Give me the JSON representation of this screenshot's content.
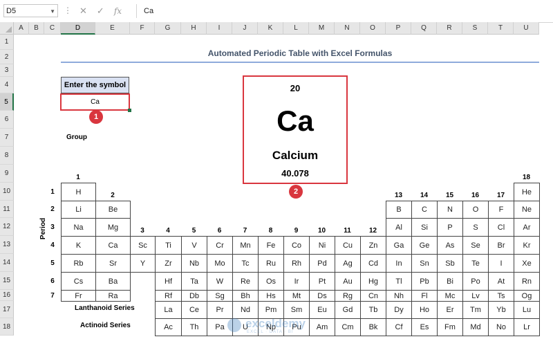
{
  "formula_bar": {
    "name_box": "D5",
    "fx_label": "fx",
    "cancel_icon": "close-icon",
    "enter_icon": "check-icon",
    "formula": "Ca"
  },
  "columns": [
    "A",
    "B",
    "C",
    "D",
    "E",
    "F",
    "G",
    "H",
    "I",
    "J",
    "K",
    "L",
    "M",
    "N",
    "O",
    "P",
    "Q",
    "R",
    "S",
    "T",
    "U"
  ],
  "rows": [
    "1",
    "2",
    "3",
    "4",
    "5",
    "6",
    "7",
    "8",
    "9",
    "10",
    "11",
    "12",
    "13",
    "14",
    "15",
    "16",
    "17",
    "18"
  ],
  "selected_column": "D",
  "selected_row": "5",
  "sheet": {
    "title": "Automated Periodic Table with Excel Formulas",
    "enter_label": "Enter the symbol",
    "input_value": "Ca",
    "badge1": "1",
    "badge2": "2",
    "group_label": "Group",
    "period_label": "Period",
    "lanthanoid_label": "Lanthanoid Series",
    "actinoid_label": "Actinoid Series"
  },
  "result_card": {
    "atomic_number": "20",
    "symbol": "Ca",
    "name": "Calcium",
    "atomic_weight": "40.078"
  },
  "groups": [
    "1",
    "2",
    "3",
    "4",
    "5",
    "6",
    "7",
    "8",
    "9",
    "10",
    "11",
    "12",
    "13",
    "14",
    "15",
    "16",
    "17",
    "18"
  ],
  "periods": [
    "1",
    "2",
    "3",
    "4",
    "5",
    "6",
    "7"
  ],
  "table": [
    [
      "H",
      "",
      "",
      "",
      "",
      "",
      "",
      "",
      "",
      "",
      "",
      "",
      "",
      "",
      "",
      "",
      "",
      "He"
    ],
    [
      "Li",
      "Be",
      "",
      "",
      "",
      "",
      "",
      "",
      "",
      "",
      "",
      "",
      "B",
      "C",
      "N",
      "O",
      "F",
      "Ne"
    ],
    [
      "Na",
      "Mg",
      "",
      "",
      "",
      "",
      "",
      "",
      "",
      "",
      "",
      "",
      "Al",
      "Si",
      "P",
      "S",
      "Cl",
      "Ar"
    ],
    [
      "K",
      "Ca",
      "Sc",
      "Ti",
      "V",
      "Cr",
      "Mn",
      "Fe",
      "Co",
      "Ni",
      "Cu",
      "Zn",
      "Ga",
      "Ge",
      "As",
      "Se",
      "Br",
      "Kr"
    ],
    [
      "Rb",
      "Sr",
      "Y",
      "Zr",
      "Nb",
      "Mo",
      "Tc",
      "Ru",
      "Rh",
      "Pd",
      "Ag",
      "Cd",
      "In",
      "Sn",
      "Sb",
      "Te",
      "I",
      "Xe"
    ],
    [
      "Cs",
      "Ba",
      "",
      "Hf",
      "Ta",
      "W",
      "Re",
      "Os",
      "Ir",
      "Pt",
      "Au",
      "Hg",
      "Tl",
      "Pb",
      "Bi",
      "Po",
      "At",
      "Rn"
    ],
    [
      "Fr",
      "Ra",
      "",
      "Rf",
      "Db",
      "Sg",
      "Bh",
      "Hs",
      "Mt",
      "Ds",
      "Rg",
      "Cn",
      "Nh",
      "Fl",
      "Mc",
      "Lv",
      "Ts",
      "Og"
    ]
  ],
  "lanthanoids": [
    "La",
    "Ce",
    "Pr",
    "Nd",
    "Pm",
    "Sm",
    "Eu",
    "Gd",
    "Tb",
    "Dy",
    "Ho",
    "Er",
    "Tm",
    "Yb",
    "Lu"
  ],
  "actinoids": [
    "Ac",
    "Th",
    "Pa",
    "U",
    "Np",
    "Pu",
    "Am",
    "Cm",
    "Bk",
    "Cf",
    "Es",
    "Fm",
    "Md",
    "No",
    "Lr"
  ],
  "watermark": {
    "brand": "exceldemy",
    "tagline": "EXCEL · DATA · BI"
  }
}
